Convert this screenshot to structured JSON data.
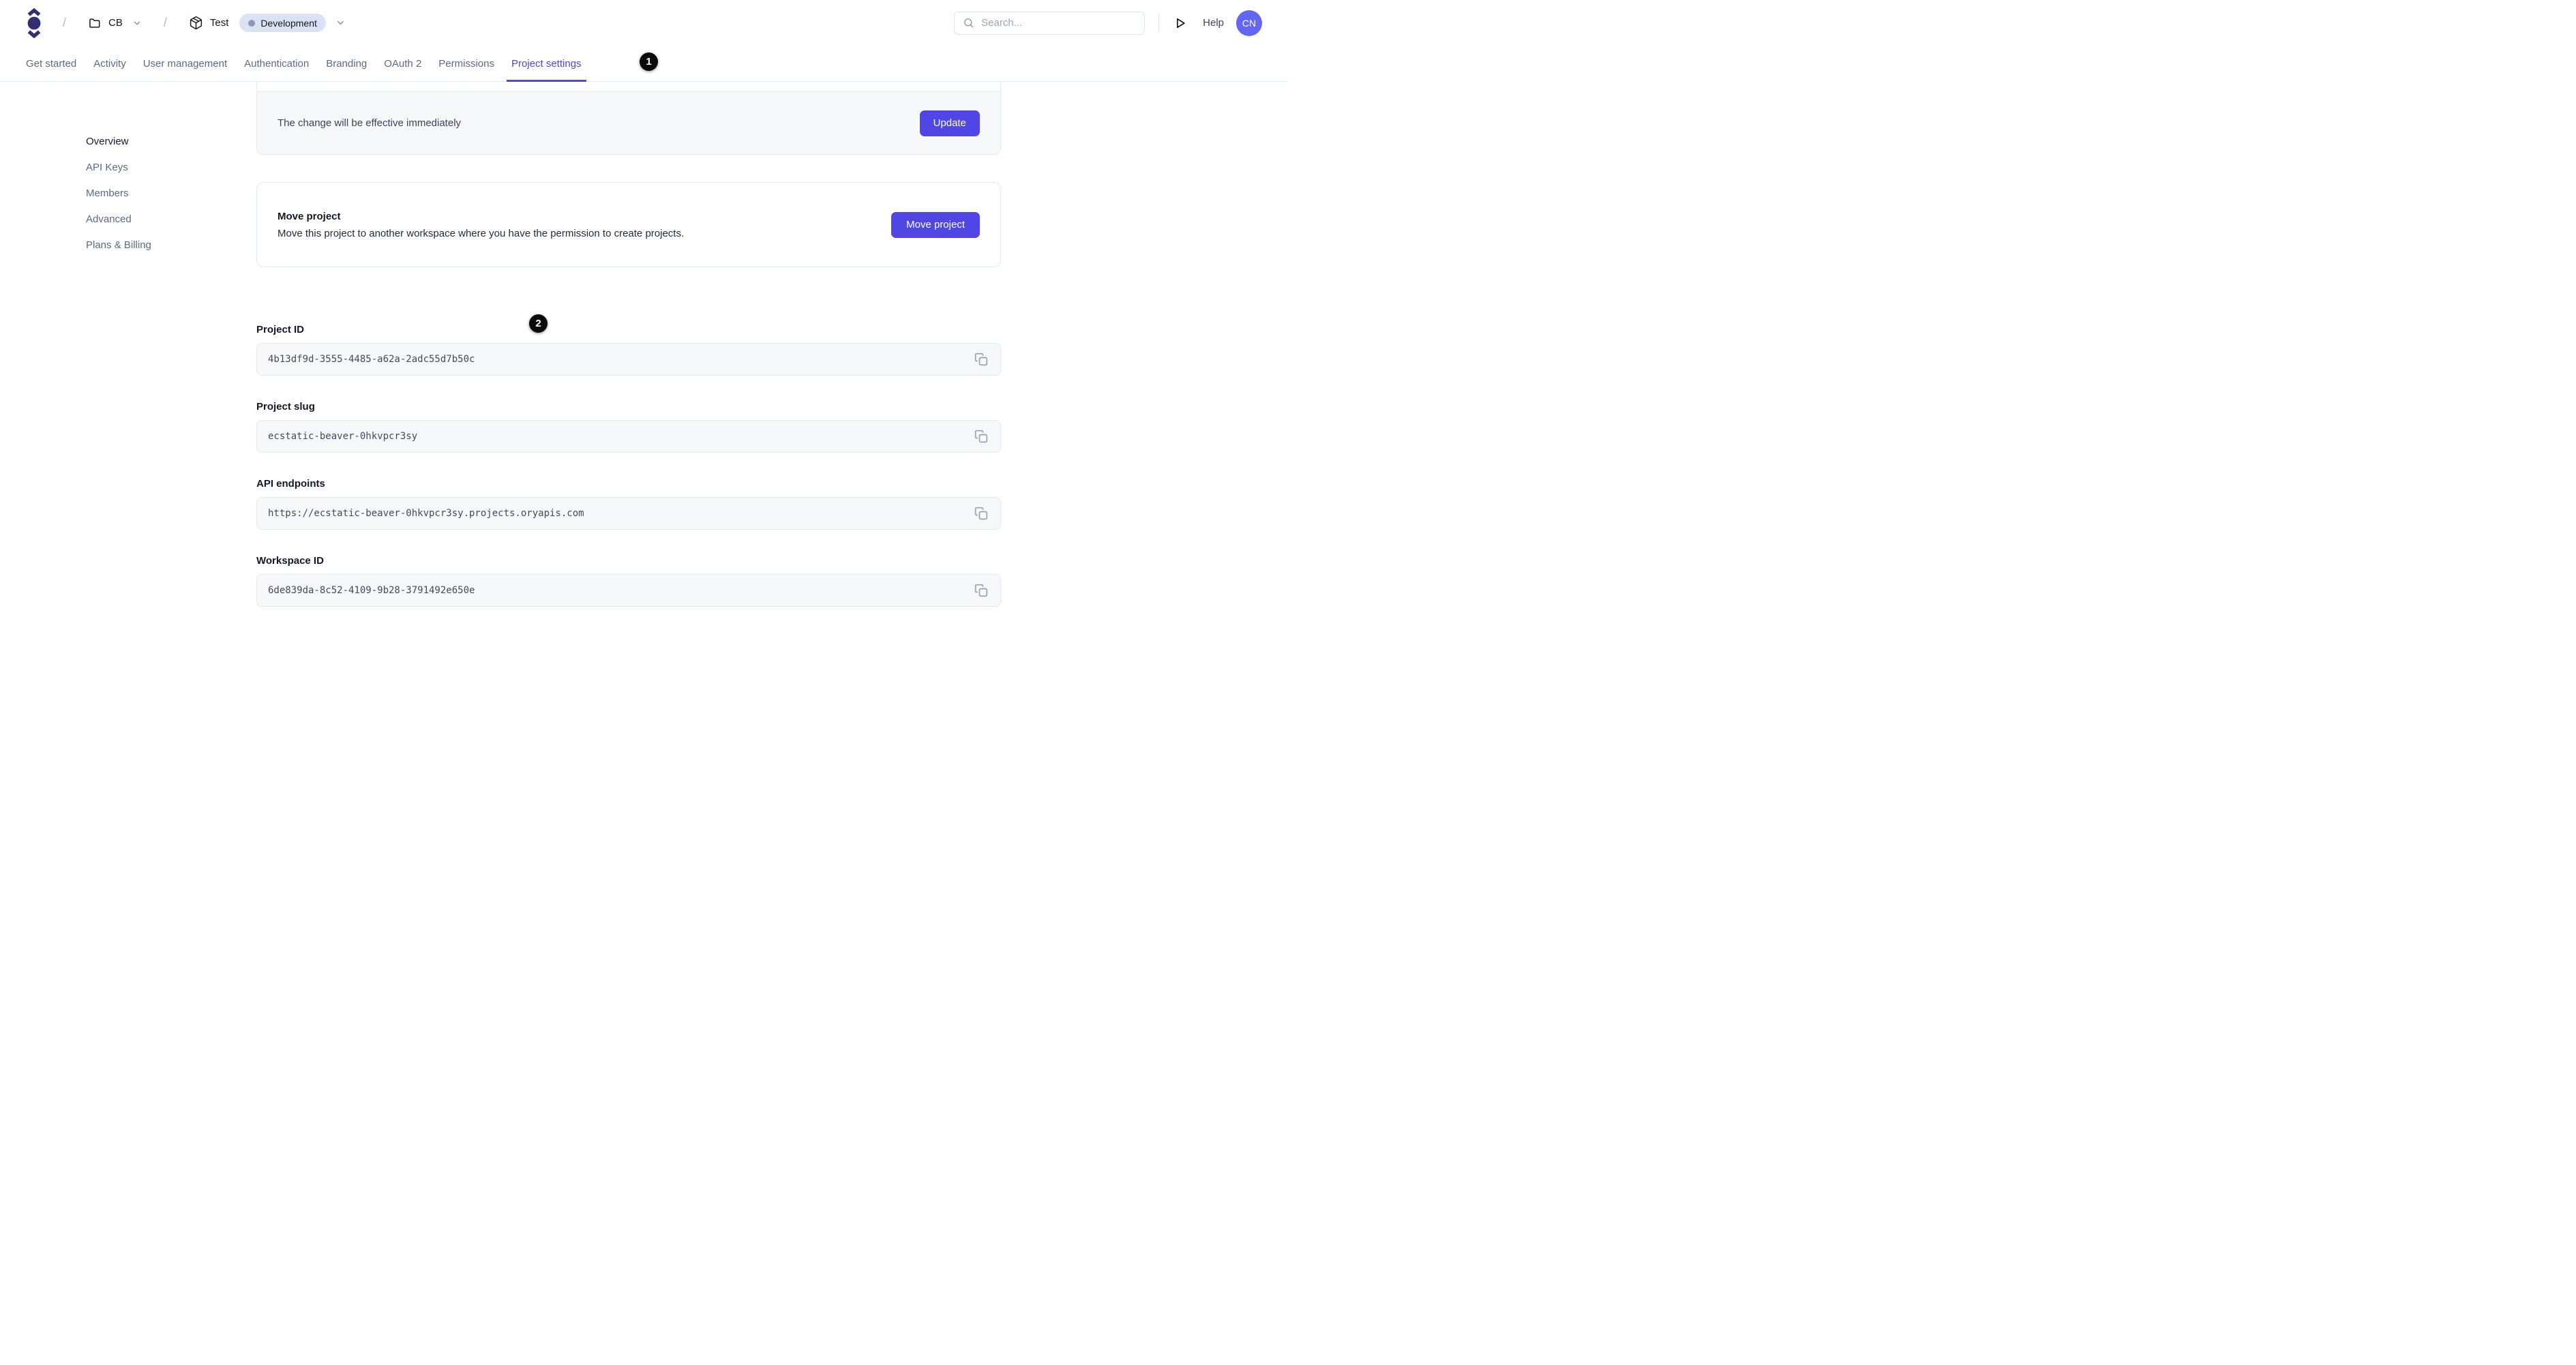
{
  "header": {
    "breadcrumb": {
      "separator": "/",
      "workspace_label": "CB",
      "project_label": "Test",
      "environment_badge": "Development"
    },
    "search_placeholder": "Search...",
    "help_label": "Help",
    "avatar_initials": "CN"
  },
  "tabs": [
    {
      "label": "Get started",
      "active": false
    },
    {
      "label": "Activity",
      "active": false
    },
    {
      "label": "User management",
      "active": false
    },
    {
      "label": "Authentication",
      "active": false
    },
    {
      "label": "Branding",
      "active": false
    },
    {
      "label": "OAuth 2",
      "active": false
    },
    {
      "label": "Permissions",
      "active": false
    },
    {
      "label": "Project settings",
      "active": true
    }
  ],
  "sidebar": {
    "items": [
      {
        "label": "Overview",
        "active": true
      },
      {
        "label": "API Keys",
        "active": false
      },
      {
        "label": "Members",
        "active": false
      },
      {
        "label": "Advanced",
        "active": false
      },
      {
        "label": "Plans & Billing",
        "active": false
      }
    ]
  },
  "main": {
    "update_card": {
      "message": "The change will be effective immediately",
      "button_label": "Update"
    },
    "move_card": {
      "title": "Move project",
      "description": "Move this project to another workspace where you have the permission to create projects.",
      "button_label": "Move project"
    },
    "fields": [
      {
        "label": "Project ID",
        "value": "4b13df9d-3555-4485-a62a-2adc55d7b50c"
      },
      {
        "label": "Project slug",
        "value": "ecstatic-beaver-0hkvpcr3sy"
      },
      {
        "label": "API endpoints",
        "value": "https://ecstatic-beaver-0hkvpcr3sy.projects.oryapis.com"
      },
      {
        "label": "Workspace ID",
        "value": "6de839da-8c52-4109-9b28-3791492e650e"
      }
    ]
  },
  "annotations": [
    {
      "label": "1"
    },
    {
      "label": "2"
    }
  ],
  "icons": {
    "logo": "ory-logo",
    "workspace": "folder-icon",
    "project": "package-icon",
    "search": "search-icon",
    "run": "play-icon",
    "copy": "copy-icon",
    "expand": "chevron-down-icon"
  },
  "colors": {
    "accent": "#4f46e5",
    "logo": "#312e72",
    "avatar_bg": "#6366f1",
    "environment_badge_bg": "#dbe2f3",
    "environment_badge_dot": "#8b99b5",
    "annotation_bg": "#000000",
    "field_bg": "#f7f8fa",
    "border": "#e4e9f0"
  }
}
